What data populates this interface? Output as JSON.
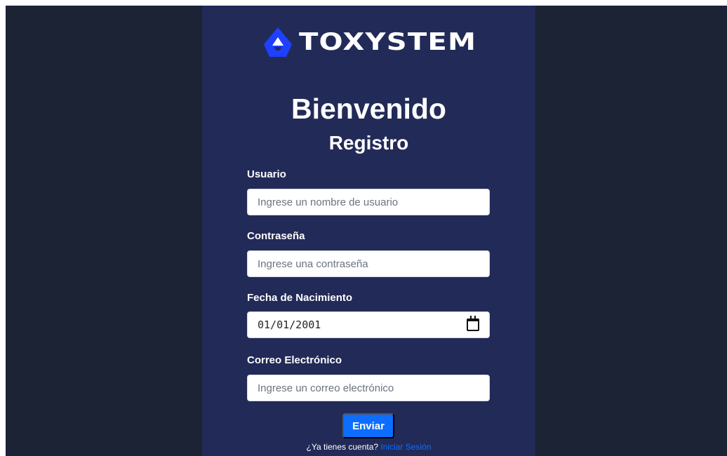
{
  "brand": {
    "name": "TOXYSTEM",
    "logo_icon": "toxystem-logo-icon",
    "logo_color": "#1e40ff"
  },
  "heading": {
    "welcome": "Bienvenido",
    "section": "Registro"
  },
  "form": {
    "username_label": "Usuario",
    "username_placeholder": "Ingrese un nombre de usuario",
    "password_label": "Contraseña",
    "password_placeholder": "Ingrese una contraseña",
    "birthdate_label": "Fecha de Nacimiento",
    "birthdate_value": "01/01/2001",
    "birthdate_icon": "calendar-icon",
    "email_label": "Correo Electrónico",
    "email_placeholder": "Ingrese un correo electrónico",
    "submit_label": "Enviar"
  },
  "footer": {
    "prompt": "¿Ya tienes cuenta?",
    "link_label": "Iniciar Sesión"
  },
  "colors": {
    "page_background": "#1b2335",
    "panel_background": "#222a58",
    "primary": "#0d6efd"
  }
}
